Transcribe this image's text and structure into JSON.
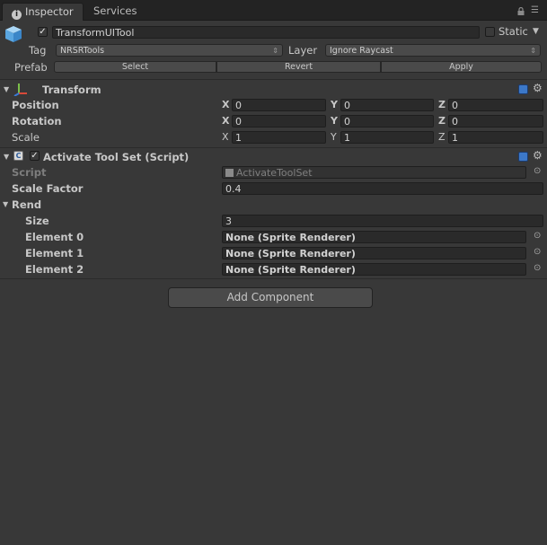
{
  "tabs": [
    {
      "label": "Inspector",
      "icon": "info-icon",
      "active": true
    },
    {
      "label": "Services",
      "active": false
    }
  ],
  "header": {
    "object_name": "TransformUITool",
    "active_checked": true,
    "static_label": "Static",
    "static_checked": false,
    "tag_label": "Tag",
    "tag_value": "NRSRTools",
    "layer_label": "Layer",
    "layer_value": "Ignore Raycast",
    "prefab_label": "Prefab",
    "prefab_buttons": [
      "Select",
      "Revert",
      "Apply"
    ]
  },
  "transform": {
    "title": "Transform",
    "rows": [
      {
        "label": "Position",
        "x": "0",
        "y": "0",
        "z": "0"
      },
      {
        "label": "Rotation",
        "x": "0",
        "y": "0",
        "z": "0"
      },
      {
        "label": "Scale",
        "x": "1",
        "y": "1",
        "z": "1"
      }
    ],
    "axis_labels": [
      "X",
      "Y",
      "Z"
    ]
  },
  "script_component": {
    "title": "Activate Tool Set (Script)",
    "enabled": true,
    "script_label": "Script",
    "script_value": "ActivateToolSet",
    "scale_factor_label": "Scale Factor",
    "scale_factor_value": "0.4",
    "rend_label": "Rend",
    "size_label": "Size",
    "size_value": "3",
    "elements": [
      {
        "label": "Element 0",
        "value": "None (Sprite Renderer)"
      },
      {
        "label": "Element 1",
        "value": "None (Sprite Renderer)"
      },
      {
        "label": "Element 2",
        "value": "None (Sprite Renderer)"
      }
    ]
  },
  "add_component_label": "Add Component",
  "colors": {
    "background": "#383838",
    "tabbar": "#232323",
    "field": "#2a2a2a",
    "button": "#4a4a4a"
  }
}
